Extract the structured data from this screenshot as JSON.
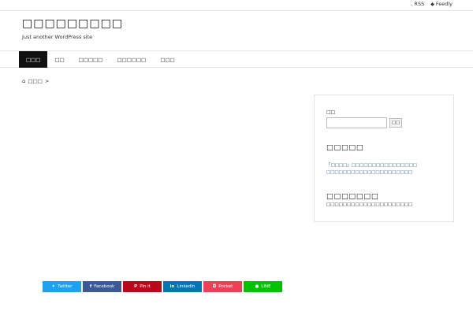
{
  "topbar": {
    "rss_label": "RSS",
    "feedly_label": "Feedly",
    "rss_icon": "rss-icon",
    "feedly_icon": "feedly-icon"
  },
  "header": {
    "site_title": "□□□□□□□□□",
    "tagline": "Just another WordPress site"
  },
  "nav": {
    "items": [
      "□□□",
      "□□",
      "□□□□□",
      "□□□□□□",
      "□□□"
    ]
  },
  "breadcrumb": {
    "home_label": "□□□",
    "separator": ">"
  },
  "sidebar": {
    "search": {
      "label": "□□",
      "placeholder": "",
      "button_label": "□□"
    },
    "recent_comments": {
      "title": "□□□□□",
      "lines": [
        "「□□□□」□□□□□□□□□□□□□□□□",
        "□□□□□□□□□□□□□□□□□□□□□"
      ]
    },
    "archive": {
      "title": "□□□□□□□",
      "text": "□□□□□□□□□□□□□□□□□□□□□"
    }
  },
  "share": {
    "twitter": "Twitter",
    "facebook": "Facebook",
    "pinit": "Pin it",
    "linkedin": "LinkedIn",
    "pocket": "Pocket",
    "line": "LINE"
  },
  "colors": {
    "twitter": "#1da1f2",
    "facebook": "#3b5998",
    "pinit": "#bd081c",
    "linkedin": "#0077b5",
    "pocket": "#ef3f56",
    "line": "#00c300"
  }
}
